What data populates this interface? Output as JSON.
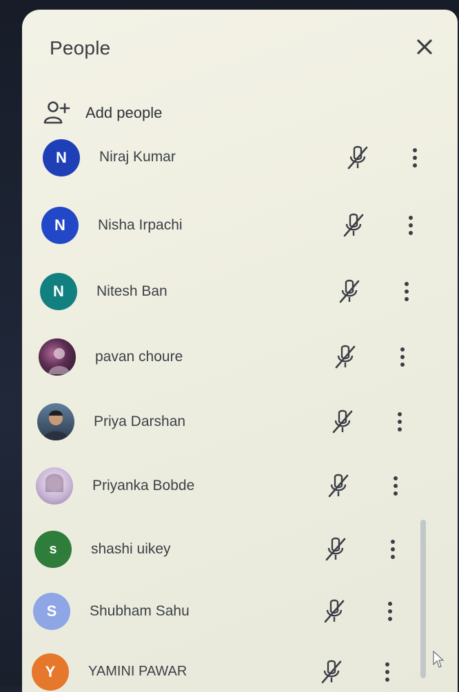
{
  "panel": {
    "title": "People",
    "close_icon": "close-icon"
  },
  "add_people": {
    "label": "Add people",
    "icon": "person-add-icon"
  },
  "participants": [
    {
      "name": "Niraj Kumar",
      "initial": "N",
      "avatar_color": "#1f3fb6",
      "avatar_type": "letter"
    },
    {
      "name": "Nisha Irpachi",
      "initial": "N",
      "avatar_color": "#2348c7",
      "avatar_type": "letter"
    },
    {
      "name": "Nitesh Ban",
      "initial": "N",
      "avatar_color": "#11807f",
      "avatar_type": "letter"
    },
    {
      "name": "pavan choure",
      "initial": "",
      "avatar_color": "#6a3a5a",
      "avatar_type": "photo"
    },
    {
      "name": "Priya Darshan",
      "initial": "",
      "avatar_color": "#3a4c63",
      "avatar_type": "photo"
    },
    {
      "name": "Priyanka Bobde",
      "initial": "",
      "avatar_color": "#c9b9d9",
      "avatar_type": "photo"
    },
    {
      "name": "shashi uikey",
      "initial": "s",
      "avatar_color": "#2e7d3a",
      "avatar_type": "letter"
    },
    {
      "name": "Shubham Sahu",
      "initial": "S",
      "avatar_color": "#8ea5e6",
      "avatar_type": "letter"
    },
    {
      "name": "YAMINI PAWAR",
      "initial": "Y",
      "avatar_color": "#e5782b",
      "avatar_type": "letter"
    }
  ],
  "row_icons": {
    "mic": "mic-off-icon",
    "more": "more-vertical-icon"
  }
}
